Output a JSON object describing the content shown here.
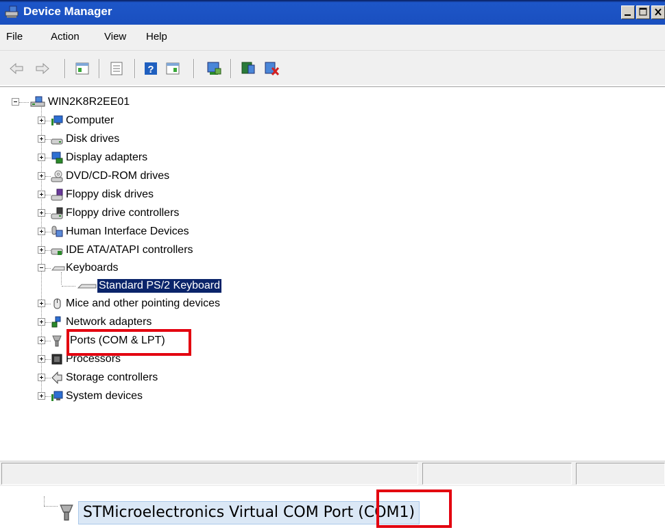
{
  "window": {
    "title": "Device Manager",
    "buttons": [
      "minimize",
      "maximize",
      "close"
    ]
  },
  "menu": {
    "items": [
      {
        "label": "File",
        "accel": "F"
      },
      {
        "label": "Action",
        "accel": "A"
      },
      {
        "label": "View",
        "accel": "V"
      },
      {
        "label": "Help",
        "accel": "H"
      }
    ]
  },
  "toolbar": {
    "buttons": [
      "back-icon",
      "forward-icon",
      "properties-icon",
      "update-icon",
      "help-icon",
      "show-hide-icon",
      "scan-hardware-icon",
      "update-driver-icon",
      "uninstall-icon"
    ]
  },
  "tree": {
    "root": "WIN2K8R2EE01",
    "categories": [
      {
        "label": "Computer",
        "icon": "computer-icon",
        "expanded": false
      },
      {
        "label": "Disk drives",
        "icon": "disk-drive-icon",
        "expanded": false
      },
      {
        "label": "Display adapters",
        "icon": "display-adapter-icon",
        "expanded": false
      },
      {
        "label": "DVD/CD-ROM drives",
        "icon": "dvd-drive-icon",
        "expanded": false
      },
      {
        "label": "Floppy disk drives",
        "icon": "floppy-drive-icon",
        "expanded": false
      },
      {
        "label": "Floppy drive controllers",
        "icon": "floppy-controller-icon",
        "expanded": false
      },
      {
        "label": "Human Interface Devices",
        "icon": "hid-icon",
        "expanded": false
      },
      {
        "label": "IDE ATA/ATAPI controllers",
        "icon": "ide-controller-icon",
        "expanded": false
      },
      {
        "label": "Keyboards",
        "icon": "keyboard-icon",
        "expanded": true
      },
      {
        "label": "Mice and other pointing devices",
        "icon": "mouse-icon",
        "expanded": false
      },
      {
        "label": "Network adapters",
        "icon": "network-adapter-icon",
        "expanded": false
      },
      {
        "label": "Ports (COM & LPT)",
        "icon": "port-icon",
        "expanded": false
      },
      {
        "label": "Processors",
        "icon": "processor-icon",
        "expanded": false
      },
      {
        "label": "Storage controllers",
        "icon": "storage-controller-icon",
        "expanded": false
      },
      {
        "label": "System devices",
        "icon": "system-device-icon",
        "expanded": false
      }
    ],
    "keyboard_child": "Standard PS/2 Keyboard"
  },
  "zoomed_item": {
    "label": "STMicroelectronics Virtual COM Port (COM1)",
    "icon": "port-icon"
  },
  "colors": {
    "highlight": "#e3000f",
    "selection": "#0a246a",
    "titlebar": "#1a4fbf"
  }
}
